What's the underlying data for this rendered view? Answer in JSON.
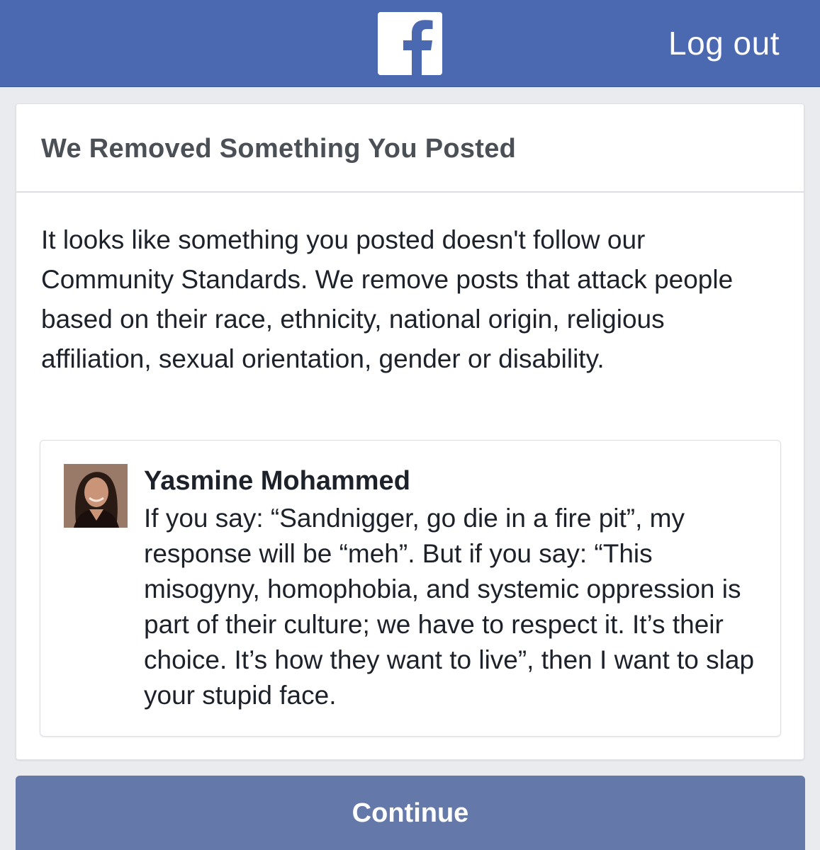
{
  "header": {
    "logo_icon": "facebook-logo-icon",
    "logout_label": "Log out",
    "bar_color": "#4b69b0"
  },
  "notice": {
    "title": "We Removed Something You Posted",
    "body": "It looks like something you posted doesn't follow our Community Standards. We remove posts that attack people based on their race, ethnicity, national origin, religious affiliation, sexual orientation, gender or disability."
  },
  "post": {
    "author": "Yasmine Mohammed",
    "avatar_icon": "profile-photo",
    "text": "If you say: “Sandnigger, go die in a fire pit”, my response will be “meh”. But if you say: “This misogyny, homophobia, and systemic oppression is part of their culture; we have to respect it. It’s their choice. It’s how they want to live”, then I want to slap your stupid face."
  },
  "actions": {
    "continue_label": "Continue",
    "button_color": "#6479aa"
  }
}
